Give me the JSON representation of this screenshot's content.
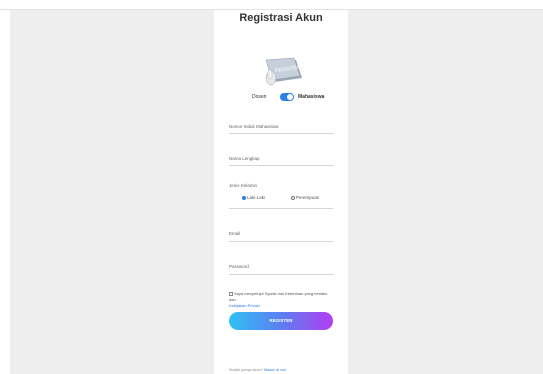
{
  "page": {
    "title": "Registrasi Akun",
    "illustration_label": "REGISTER",
    "role_toggle": {
      "left_label": "Dosen",
      "right_label": "Mahasiswa"
    },
    "fields": {
      "nim_label": "Nomor Induk Mahasiswa",
      "name_label": "Nama Lengkap",
      "email_label": "Email",
      "password_label": "Password"
    },
    "gender": {
      "label": "Jenis Kelamin",
      "options": [
        "Laki-Laki",
        "Perempuan"
      ]
    },
    "consent_text": "Saya menyetujui Syarat dan Ketentuan yang berlaku dan",
    "consent_link": "Kebijakan Privasi",
    "register_button": "REGISTER",
    "footer_text": "Sudah punya akun?",
    "footer_link": "Masuk di sini"
  }
}
